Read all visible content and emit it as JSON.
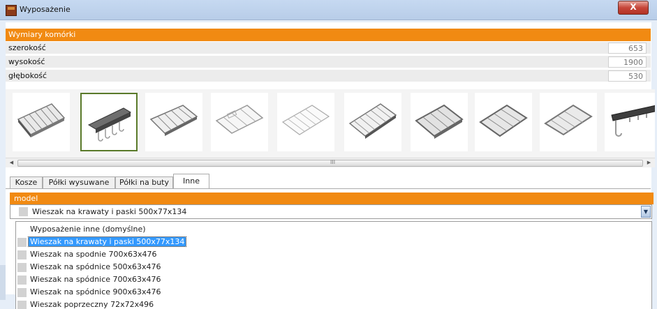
{
  "window": {
    "title": "Wyposażenie",
    "close_label": "X"
  },
  "dimensions": {
    "header": "Wymiary komórki",
    "rows": [
      {
        "label": "szerokość",
        "value": "653"
      },
      {
        "label": "wysokość",
        "value": "1900"
      },
      {
        "label": "głębokość",
        "value": "530"
      }
    ]
  },
  "gallery": {
    "scroll_grip": "III",
    "item_count": 10,
    "selected_index": 1
  },
  "tabs": [
    {
      "label": "Kosze"
    },
    {
      "label": "Półki wysuwane"
    },
    {
      "label": "Półki na buty"
    },
    {
      "label": "Inne"
    }
  ],
  "model": {
    "header": "model",
    "selected_value": "Wieszak na krawaty i paski 500x77x134",
    "options": [
      {
        "label": "Wyposażenie inne (domyślne)"
      },
      {
        "label": "Wieszak na krawaty i paski 500x77x134"
      },
      {
        "label": "Wieszak na spodnie 700x63x476"
      },
      {
        "label": "Wieszak na spódnice 500x63x476"
      },
      {
        "label": "Wieszak na spódnice 700x63x476"
      },
      {
        "label": "Wieszak na spódnice 900x63x476"
      },
      {
        "label": "Wieszak poprzeczny 72x72x496"
      }
    ]
  },
  "colors": {
    "accent": "#f18a12",
    "selection": "#3399ff",
    "thumb_border": "#5a7a2a"
  }
}
